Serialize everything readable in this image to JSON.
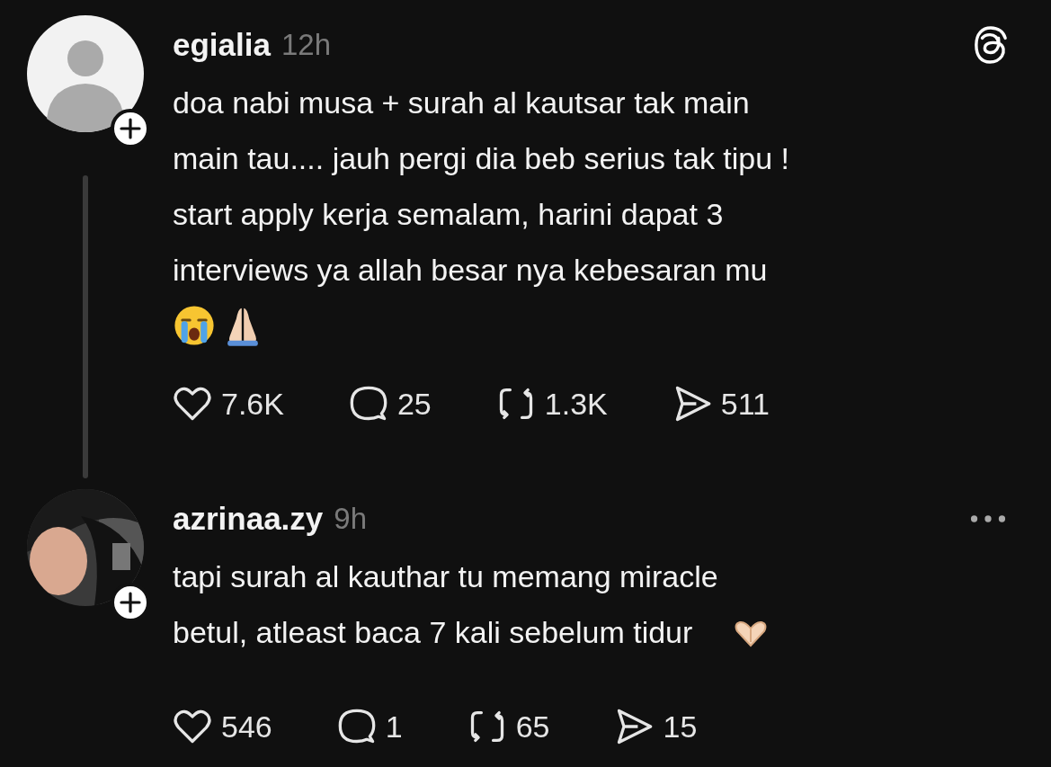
{
  "posts": [
    {
      "username": "egialia",
      "time": "12h",
      "menu": {
        "kind": "logo"
      },
      "text_lines": [
        "doa nabi musa + surah al kautsar tak main",
        "main tau.... jauh pergi dia beb serius tak tipu !",
        "start apply kerja semalam, harini dapat 3",
        "interviews ya allah besar nya kebesaran mu"
      ],
      "emoji": [
        {
          "kind": "crying"
        },
        {
          "kind": "pray"
        }
      ],
      "avatar": {
        "kind": "placeholder"
      },
      "thread_line": true,
      "stats": {
        "likes": "7.6K",
        "replies": "25",
        "reposts": "1.3K",
        "shares": "511"
      }
    },
    {
      "username": "azrinaa.zy",
      "time": "9h",
      "menu": {
        "kind": "more"
      },
      "text_lines": [
        "tapi surah al kauthar tu memang miracle",
        "betul, atleast baca 7 kali sebelum tidur"
      ],
      "emoji_inline": [
        {
          "kind": "heart-hands"
        }
      ],
      "avatar": {
        "kind": "picture"
      },
      "thread_line": false,
      "stats": {
        "likes": "546",
        "replies": "1",
        "reposts": "65",
        "shares": "15"
      }
    }
  ]
}
